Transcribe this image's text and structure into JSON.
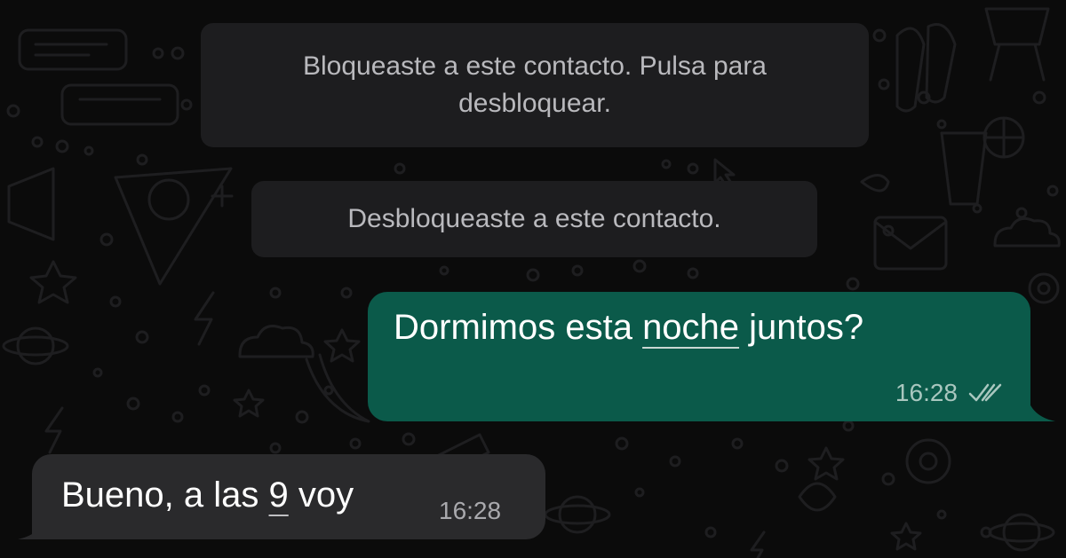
{
  "colors": {
    "background": "#0b0b0b",
    "system_bubble": "#1d1d1f",
    "outgoing_bubble": "#0b5a4a",
    "incoming_bubble": "#2a2a2c",
    "doodle_stroke": "#1f1f21"
  },
  "system_messages": [
    {
      "line1": "Bloqueaste a este contacto. Pulsa para",
      "line2": "desbloquear."
    },
    {
      "text": "Desbloqueaste a este contacto."
    }
  ],
  "messages": [
    {
      "direction": "outgoing",
      "text_before": "Dormimos esta ",
      "text_link": "noche",
      "text_after": " juntos?",
      "time": "16:28",
      "status_icon": "double-check-icon"
    },
    {
      "direction": "incoming",
      "text_before": "Bueno, a las ",
      "text_link": "9",
      "text_after": " voy",
      "time": "16:28"
    }
  ]
}
